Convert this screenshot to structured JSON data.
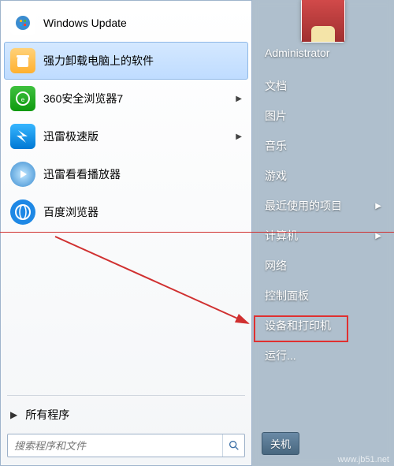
{
  "programs": [
    {
      "label": "Windows Update",
      "icon": "windows-update-icon",
      "submenu": false,
      "selected": false
    },
    {
      "label": "强力卸载电脑上的软件",
      "icon": "uninstall-icon",
      "submenu": false,
      "selected": true
    },
    {
      "label": "360安全浏览器7",
      "icon": "360-browser-icon",
      "submenu": true,
      "selected": false
    },
    {
      "label": "迅雷极速版",
      "icon": "xunlei-speed-icon",
      "submenu": true,
      "selected": false
    },
    {
      "label": "迅雷看看播放器",
      "icon": "xunlei-kankan-icon",
      "submenu": false,
      "selected": false
    },
    {
      "label": "百度浏览器",
      "icon": "baidu-browser-icon",
      "submenu": false,
      "selected": false
    }
  ],
  "allPrograms": {
    "label": "所有程序"
  },
  "search": {
    "placeholder": "搜索程序和文件"
  },
  "rightPanel": {
    "user": "Administrator",
    "items": [
      {
        "label": "文档",
        "submenu": false,
        "highlight": false
      },
      {
        "label": "图片",
        "submenu": false,
        "highlight": false
      },
      {
        "label": "音乐",
        "submenu": false,
        "highlight": false
      },
      {
        "label": "游戏",
        "submenu": false,
        "highlight": false
      },
      {
        "label": "最近使用的项目",
        "submenu": true,
        "highlight": false
      },
      {
        "label": "计算机",
        "submenu": true,
        "highlight": false
      },
      {
        "label": "网络",
        "submenu": false,
        "highlight": false
      },
      {
        "label": "控制面板",
        "submenu": false,
        "highlight": true
      },
      {
        "label": "设备和打印机",
        "submenu": false,
        "highlight": false
      },
      {
        "label": "运行...",
        "submenu": false,
        "highlight": false
      }
    ]
  },
  "shutdown": {
    "label": "关机"
  },
  "watermark": "www.jb51.net",
  "colors": {
    "highlight": "#e03030"
  }
}
